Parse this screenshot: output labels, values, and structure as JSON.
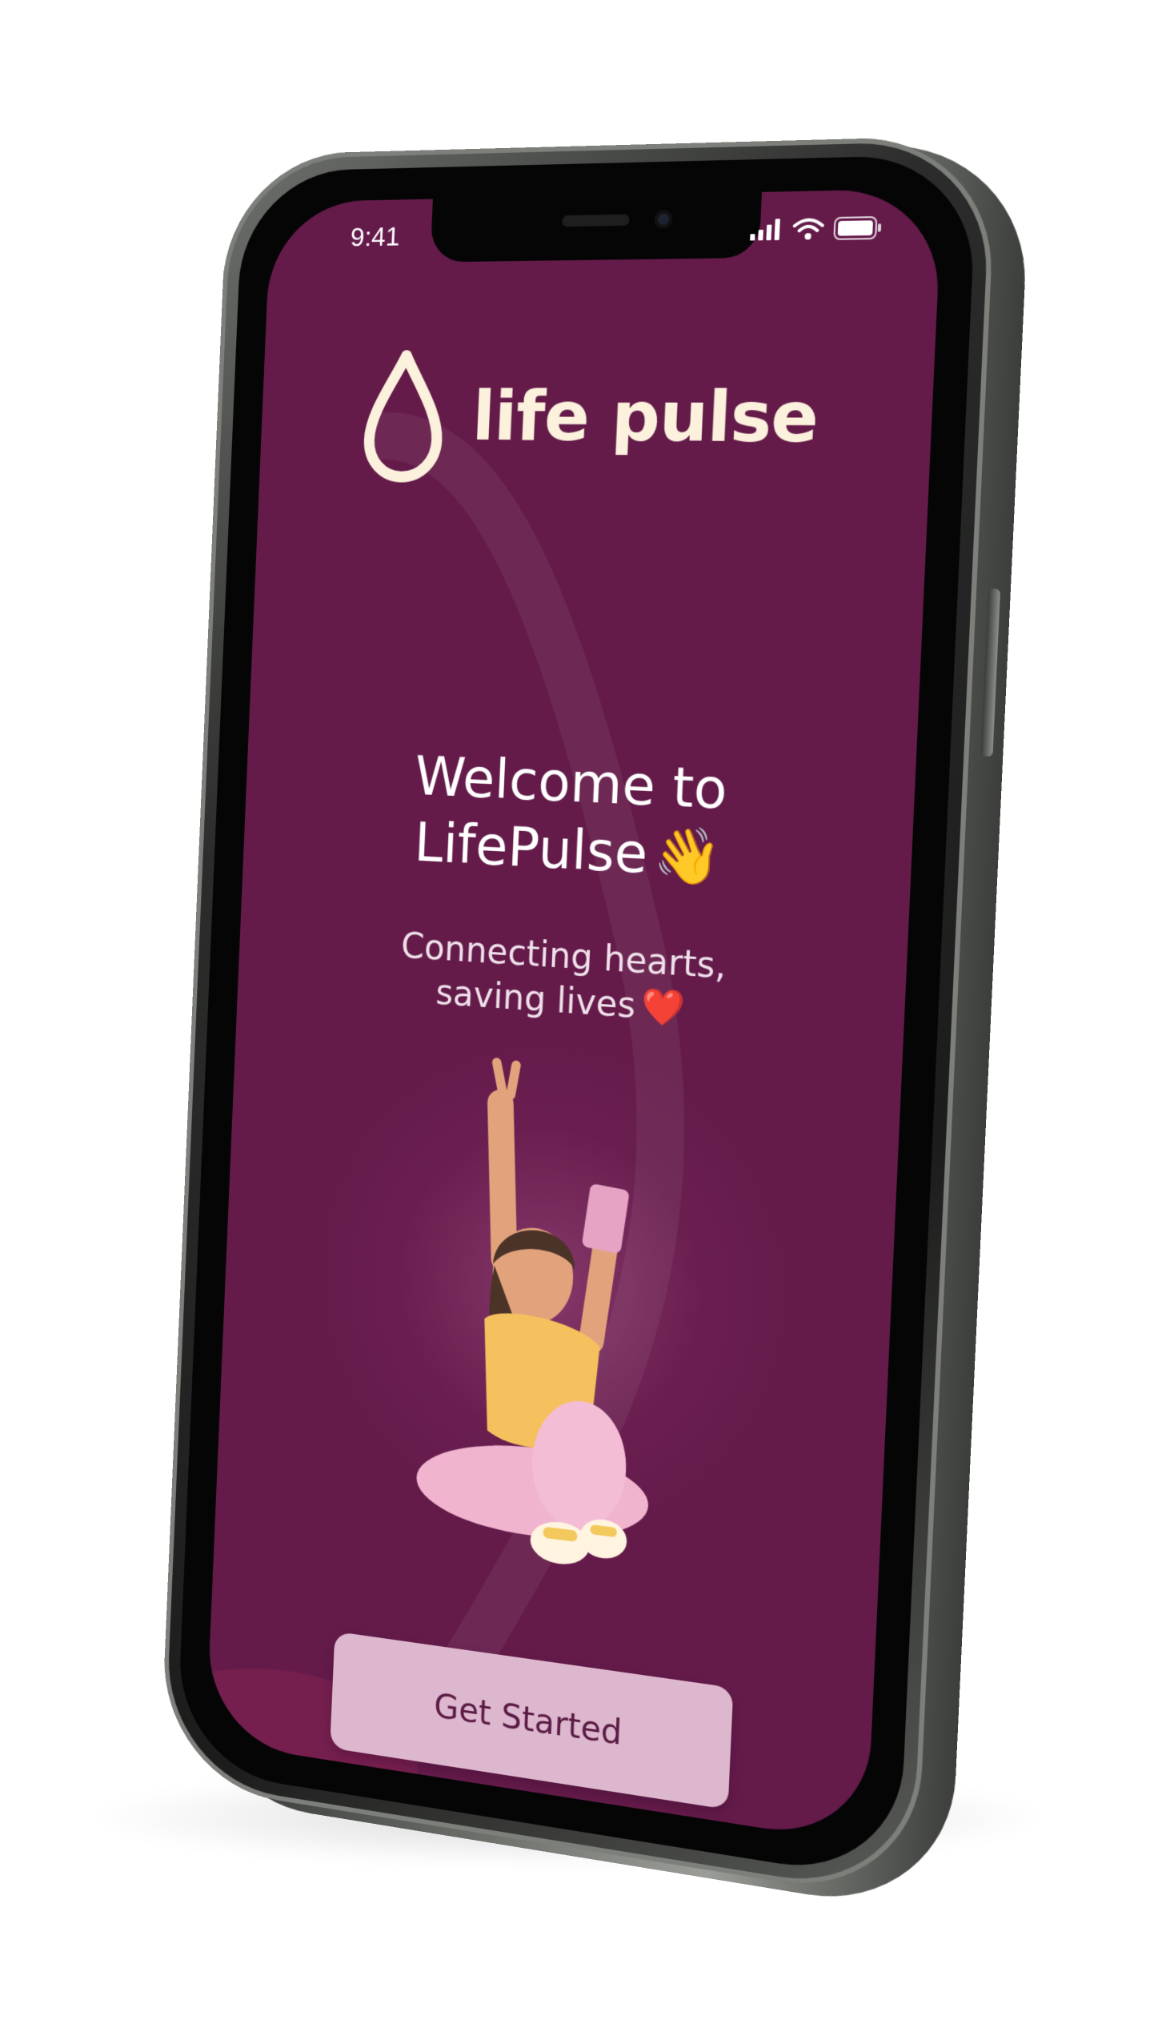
{
  "status_bar": {
    "time": "9:41"
  },
  "brand": {
    "name": "life pulse",
    "icon": "blood-drop-icon"
  },
  "welcome": {
    "line1": "Welcome to",
    "line2": "LifePulse",
    "emoji": "👋"
  },
  "tagline": {
    "line1": "Connecting hearts,",
    "line2": "saving lives",
    "emoji": "❤️"
  },
  "cta": {
    "label": "Get Started"
  },
  "colors": {
    "background": "#641b4a",
    "logo": "#fbf1dc",
    "button": "#ddb7cd",
    "button_text": "#5a1b45"
  }
}
